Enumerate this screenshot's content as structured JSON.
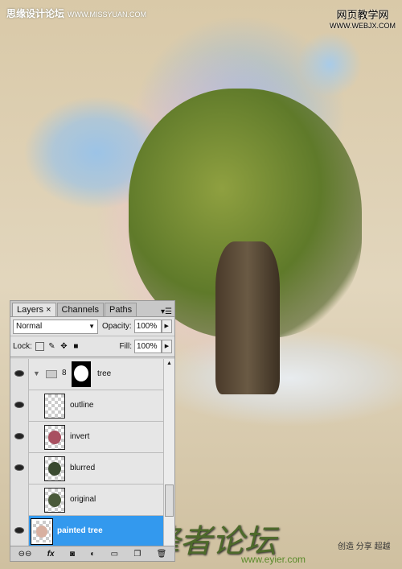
{
  "watermarks": {
    "top_left": "思缘设计论坛",
    "top_left_url": "WWW.MISSYUAN.COM",
    "top_right": "网页教学网",
    "top_right_url": "WWW.WEBJX.COM",
    "brand": "e锋者论坛",
    "brand_url": "www.eyier.com",
    "slogan": "创造 分享 超越"
  },
  "panel": {
    "tabs": [
      {
        "label": "Layers ×"
      },
      {
        "label": "Channels"
      },
      {
        "label": "Paths"
      }
    ],
    "blend_mode": "Normal",
    "opacity_label": "Opacity:",
    "opacity": "100%",
    "lock_label": "Lock:",
    "fill_label": "Fill:",
    "fill": "100%",
    "layers": [
      {
        "name": "tree",
        "visible": true,
        "type": "group"
      },
      {
        "name": "outline",
        "visible": true
      },
      {
        "name": "invert",
        "visible": true
      },
      {
        "name": "blurred",
        "visible": true
      },
      {
        "name": "original",
        "visible": false
      },
      {
        "name": "painted tree",
        "visible": true,
        "selected": true
      }
    ],
    "bottom_icons": [
      "link-icon",
      "fx-icon",
      "mask-icon",
      "adjustment-icon",
      "folder-icon",
      "new-layer-icon",
      "trash-icon"
    ]
  },
  "colors": {
    "selection": "#3399ee"
  }
}
